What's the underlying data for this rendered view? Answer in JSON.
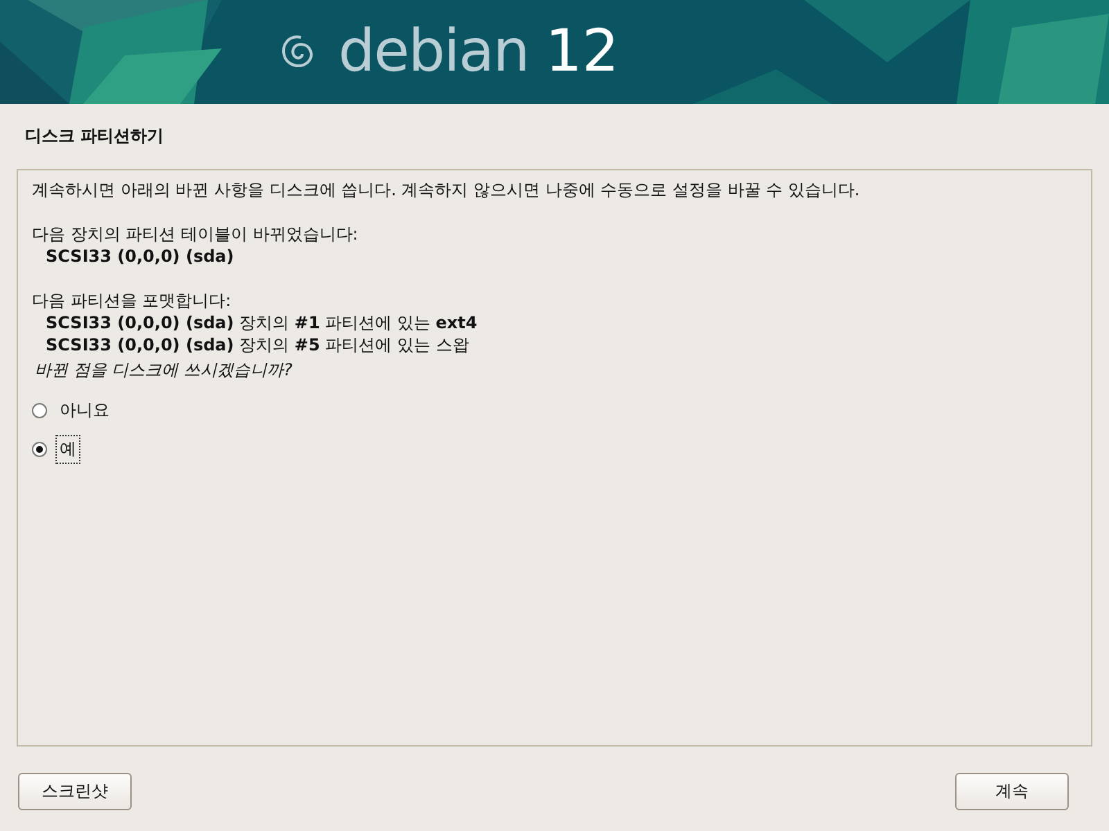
{
  "banner": {
    "logo_text": "debian",
    "version": "12"
  },
  "title": "디스크 파티션하기",
  "intro": "계속하시면 아래의 바뀐 사항을 디스크에 씁니다. 계속하지 않으시면 나중에 수동으로 설정을 바꿀 수 있습니다.",
  "sections": [
    {
      "heading": "다음 장치의 파티션 테이블이 바뀌었습니다:",
      "items": [
        "**SCSI33 (0,0,0) (sda)**"
      ]
    },
    {
      "heading": "다음 파티션을 포맷합니다:",
      "items": [
        "**SCSI33 (0,0,0) (sda)** 장치의 **#1** 파티션에 있는 **ext4**",
        "**SCSI33 (0,0,0) (sda)** 장치의 **#5** 파티션에 있는 스왑"
      ]
    }
  ],
  "question": "바뀐 점을 디스크에 쓰시겠습니까?",
  "options": [
    {
      "label": "아니요",
      "selected": false
    },
    {
      "label": "예",
      "selected": true
    }
  ],
  "buttons": {
    "left": "스크린샷",
    "right": "계속"
  }
}
